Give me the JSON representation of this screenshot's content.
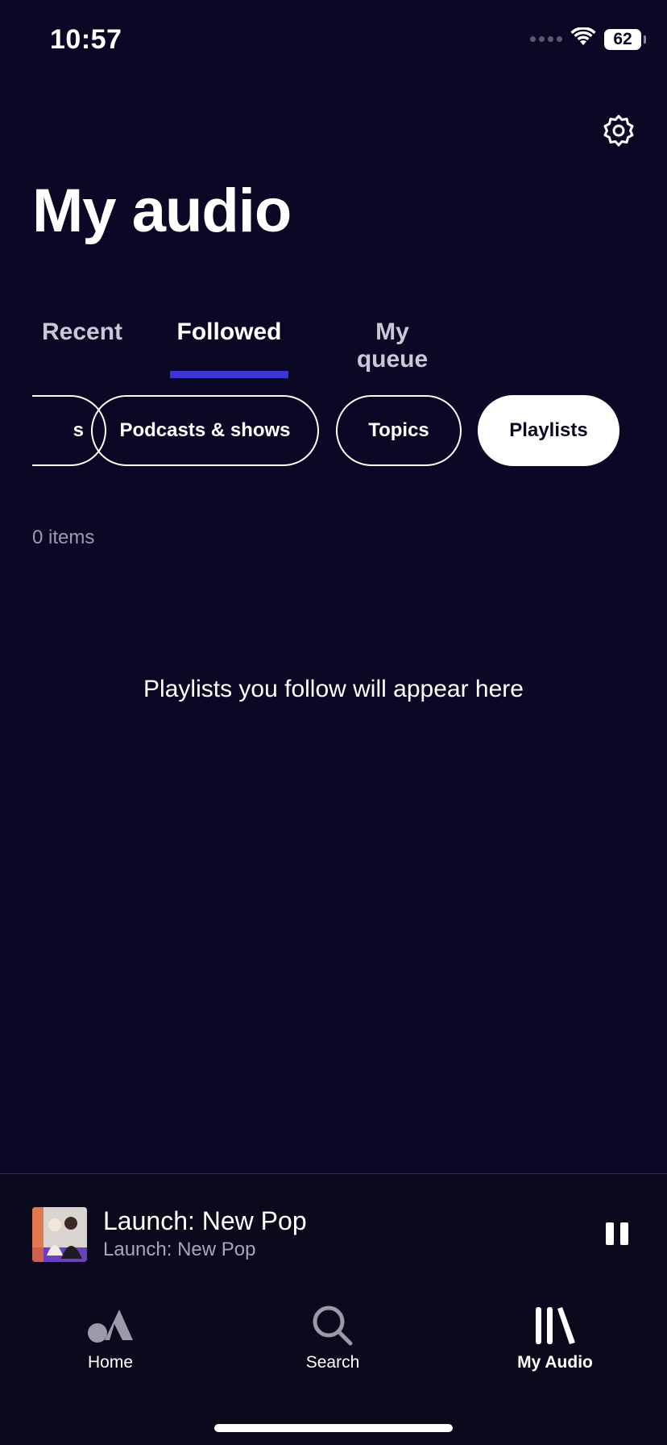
{
  "status_bar": {
    "time": "10:57",
    "battery": "62"
  },
  "header": {
    "title": "My audio",
    "settings_icon": "gear-icon"
  },
  "tabs": [
    {
      "label": "Recent",
      "active": false
    },
    {
      "label": "Followed",
      "active": true
    },
    {
      "label": "My queue",
      "active": false
    }
  ],
  "filters": [
    {
      "label": "s",
      "selected": false
    },
    {
      "label": "Podcasts & shows",
      "selected": false
    },
    {
      "label": "Topics",
      "selected": false
    },
    {
      "label": "Playlists",
      "selected": true
    }
  ],
  "content": {
    "item_count": "0 items",
    "empty_message": "Playlists you follow will appear here"
  },
  "now_playing": {
    "title": "Launch: New Pop",
    "subtitle": "Launch: New Pop",
    "control_icon": "pause-icon"
  },
  "bottom_nav": [
    {
      "label": "Home",
      "icon": "home-icon",
      "active": false
    },
    {
      "label": "Search",
      "icon": "search-icon",
      "active": false
    },
    {
      "label": "My Audio",
      "icon": "library-icon",
      "active": true
    }
  ],
  "colors": {
    "background": "#0a0824",
    "accent": "#3b36d4",
    "muted_text": "#9c9bb0"
  }
}
